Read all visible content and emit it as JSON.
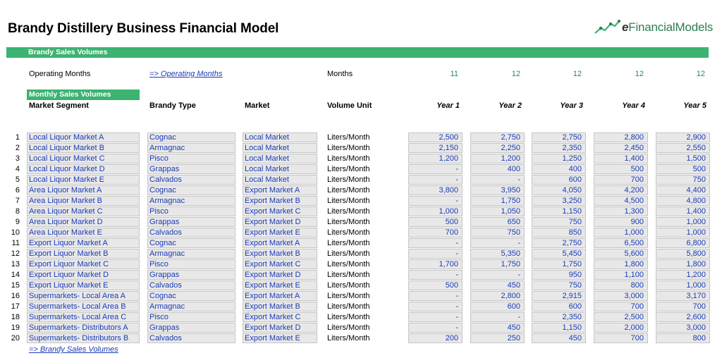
{
  "title": "Brandy Distillery Business Financial Model",
  "logo": {
    "prefix": "e",
    "text": "FinancialModels"
  },
  "section_title": "Brandy Sales Volumes",
  "operating": {
    "label": "Operating Months",
    "link": "=> Operating Months",
    "unit": "Months",
    "values": [
      "11",
      "12",
      "12",
      "12",
      "12"
    ]
  },
  "subsection_title": "Monthly Sales Volumes",
  "headers": {
    "market_segment": "Market Segment",
    "brandy_type": "Brandy Type",
    "market": "Market",
    "volume_unit": "Volume Unit",
    "years": [
      "Year 1",
      "Year 2",
      "Year 3",
      "Year 4",
      "Year 5"
    ]
  },
  "rows": [
    {
      "n": "1",
      "segment": "Local Liquor Market A",
      "type": "Cognac",
      "market": "Local Market",
      "unit": "Liters/Month",
      "y": [
        "2,500",
        "2,750",
        "2,750",
        "2,800",
        "2,900"
      ]
    },
    {
      "n": "2",
      "segment": "Local Liquor Market B",
      "type": "Armagnac",
      "market": "Local Market",
      "unit": "Liters/Month",
      "y": [
        "2,150",
        "2,250",
        "2,350",
        "2,450",
        "2,550"
      ]
    },
    {
      "n": "3",
      "segment": "Local Liquor Market C",
      "type": "Pisco",
      "market": "Local Market",
      "unit": "Liters/Month",
      "y": [
        "1,200",
        "1,200",
        "1,250",
        "1,400",
        "1,500"
      ]
    },
    {
      "n": "4",
      "segment": "Local Liquor Market D",
      "type": "Grappas",
      "market": "Local Market",
      "unit": "Liters/Month",
      "y": [
        "-",
        "400",
        "400",
        "500",
        "500"
      ]
    },
    {
      "n": "5",
      "segment": "Local Liquor Market E",
      "type": "Calvados",
      "market": "Local Market",
      "unit": "Liters/Month",
      "y": [
        "-",
        "-",
        "600",
        "700",
        "750"
      ]
    },
    {
      "n": "6",
      "segment": "Area Liquor Market A",
      "type": "Cognac",
      "market": "Export Market A",
      "unit": "Liters/Month",
      "y": [
        "3,800",
        "3,950",
        "4,050",
        "4,200",
        "4,400"
      ]
    },
    {
      "n": "7",
      "segment": "Area Liquor Market B",
      "type": "Armagnac",
      "market": "Export Market B",
      "unit": "Liters/Month",
      "y": [
        "-",
        "1,750",
        "3,250",
        "4,500",
        "4,800"
      ]
    },
    {
      "n": "8",
      "segment": "Area Liquor Market C",
      "type": "Pisco",
      "market": "Export Market C",
      "unit": "Liters/Month",
      "y": [
        "1,000",
        "1,050",
        "1,150",
        "1,300",
        "1,400"
      ]
    },
    {
      "n": "9",
      "segment": "Area Liquor Market D",
      "type": "Grappas",
      "market": "Export Market D",
      "unit": "Liters/Month",
      "y": [
        "500",
        "650",
        "750",
        "900",
        "1,000"
      ]
    },
    {
      "n": "10",
      "segment": "Area Liquor Market E",
      "type": "Calvados",
      "market": "Export Market E",
      "unit": "Liters/Month",
      "y": [
        "700",
        "750",
        "850",
        "1,000",
        "1,000"
      ]
    },
    {
      "n": "11",
      "segment": "Export Liquor Market A",
      "type": "Cognac",
      "market": "Export Market A",
      "unit": "Liters/Month",
      "y": [
        "-",
        "-",
        "2,750",
        "6,500",
        "6,800"
      ]
    },
    {
      "n": "12",
      "segment": "Export Liquor Market B",
      "type": "Armagnac",
      "market": "Export Market B",
      "unit": "Liters/Month",
      "y": [
        "-",
        "5,350",
        "5,450",
        "5,600",
        "5,800"
      ]
    },
    {
      "n": "13",
      "segment": "Export Liquor Market C",
      "type": "Pisco",
      "market": "Export Market C",
      "unit": "Liters/Month",
      "y": [
        "1,700",
        "1,750",
        "1,750",
        "1,800",
        "1,800"
      ]
    },
    {
      "n": "14",
      "segment": "Export Liquor Market D",
      "type": "Grappas",
      "market": "Export Market D",
      "unit": "Liters/Month",
      "y": [
        "-",
        "-",
        "950",
        "1,100",
        "1,200"
      ]
    },
    {
      "n": "15",
      "segment": "Export Liquor Market E",
      "type": "Calvados",
      "market": "Export Market E",
      "unit": "Liters/Month",
      "y": [
        "500",
        "450",
        "750",
        "800",
        "1,000"
      ]
    },
    {
      "n": "16",
      "segment": "Supermarkets- Local Area A",
      "type": "Cognac",
      "market": "Export Market A",
      "unit": "Liters/Month",
      "y": [
        "-",
        "2,800",
        "2,915",
        "3,000",
        "3,170"
      ]
    },
    {
      "n": "17",
      "segment": "Supermarkets- Local Area B",
      "type": "Armagnac",
      "market": "Export Market B",
      "unit": "Liters/Month",
      "y": [
        "-",
        "600",
        "600",
        "700",
        "700"
      ]
    },
    {
      "n": "18",
      "segment": "Supermarkets- Local Area C",
      "type": "Pisco",
      "market": "Export Market C",
      "unit": "Liters/Month",
      "y": [
        "-",
        "-",
        "2,350",
        "2,500",
        "2,600"
      ]
    },
    {
      "n": "19",
      "segment": "Supermarkets- Distributors A",
      "type": "Grappas",
      "market": "Export Market D",
      "unit": "Liters/Month",
      "y": [
        "-",
        "450",
        "1,150",
        "2,000",
        "3,000"
      ]
    },
    {
      "n": "20",
      "segment": "Supermarkets- Distributors B",
      "type": "Calvados",
      "market": "Export Market E",
      "unit": "Liters/Month",
      "y": [
        "200",
        "250",
        "450",
        "700",
        "800"
      ]
    }
  ],
  "footer_link": "=>  Brandy Sales Volumes"
}
